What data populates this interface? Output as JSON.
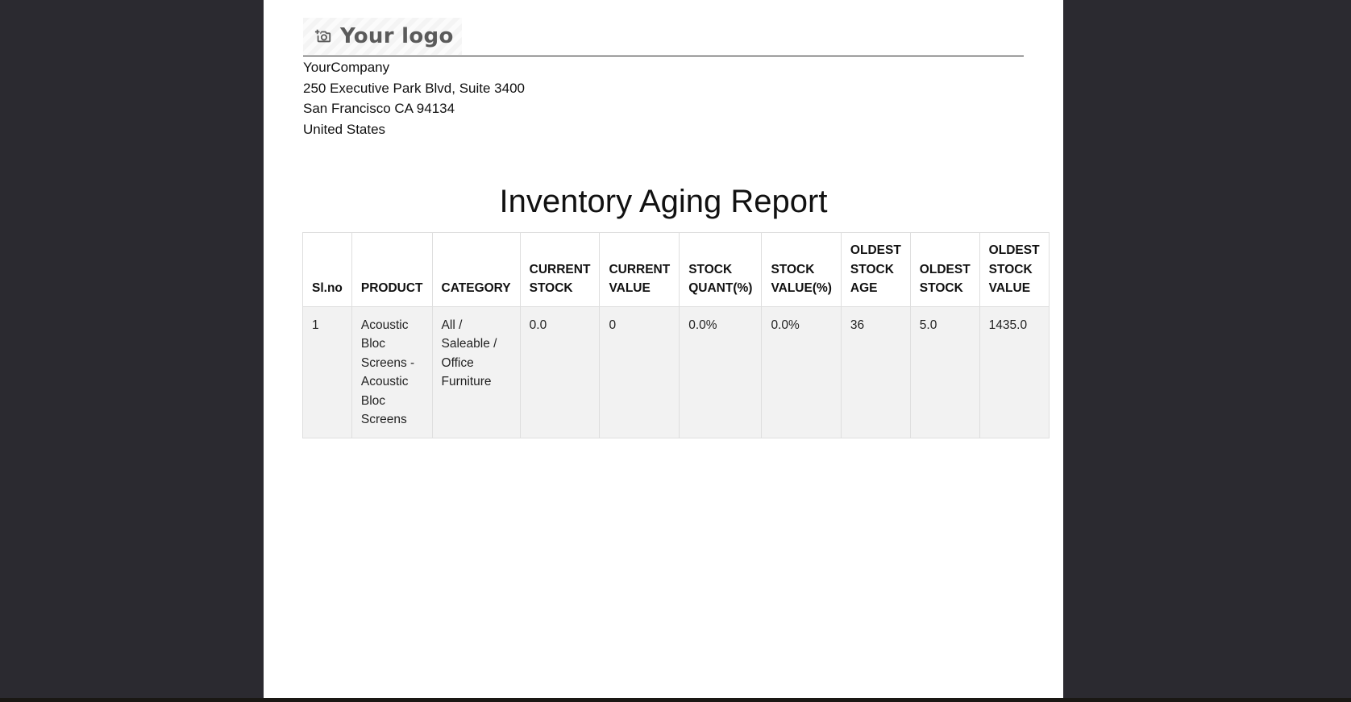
{
  "company": {
    "logo_text": "Your logo",
    "logo_icon": "camera-plus-icon",
    "name": "YourCompany",
    "address_line1": "250 Executive Park Blvd, Suite 3400",
    "address_line2": "San Francisco CA 94134",
    "country": "United States"
  },
  "report": {
    "title": "Inventory Aging Report",
    "columns": {
      "slno": "Sl.no",
      "product": "PRODUCT",
      "category": "CATEGORY",
      "current_stock": "CURRENT STOCK",
      "current_value": "CURRENT VALUE",
      "stock_quant": "STOCK QUANT(%)",
      "stock_value": "STOCK VALUE(%)",
      "oldest_age": "OLDEST STOCK AGE",
      "oldest_stock": "OLDEST STOCK",
      "oldest_value": "OLDEST STOCK VALUE"
    },
    "rows": [
      {
        "slno": "1",
        "product": "Acoustic Bloc Screens - Acoustic Bloc Screens",
        "category": "All / Saleable / Office Furniture",
        "current_stock": "0.0",
        "current_value": "0",
        "stock_quant": "0.0%",
        "stock_value": "0.0%",
        "oldest_age": "36",
        "oldest_stock": "5.0",
        "oldest_value": "1435.0"
      }
    ]
  },
  "colors": {
    "viewer_background": "#2b2a30",
    "page_background": "#ffffff",
    "row_background": "#f2f2f2",
    "border": "#dedede"
  }
}
